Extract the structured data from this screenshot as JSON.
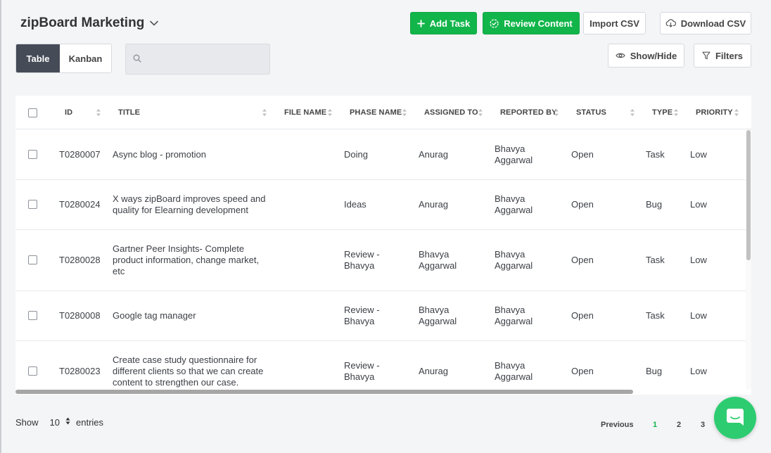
{
  "header": {
    "project_name": "zipBoard Marketing",
    "add_task": "Add Task",
    "review_content": "Review Content",
    "import_csv": "Import CSV",
    "download_csv": "Download CSV",
    "show_hide": "Show/Hide",
    "filters": "Filters"
  },
  "view_toggle": {
    "table": "Table",
    "kanban": "Kanban",
    "active": "Table"
  },
  "search": {
    "placeholder": ""
  },
  "table": {
    "columns": [
      "ID",
      "TITLE",
      "FILE NAME",
      "PHASE NAME",
      "ASSIGNED TO",
      "REPORTED BY",
      "STATUS",
      "TYPE",
      "PRIORITY"
    ],
    "rows": [
      {
        "id": "T0280007",
        "title": [
          "Async blog - promotion"
        ],
        "file_name": "",
        "phase": [
          "Doing"
        ],
        "assigned": [
          "Anurag"
        ],
        "reported": [
          "Bhavya",
          "Aggarwal"
        ],
        "status": "Open",
        "type": "Task",
        "priority": "Low"
      },
      {
        "id": "T0280024",
        "title": [
          "X ways zipBoard improves speed and",
          "quality for Elearning development"
        ],
        "file_name": "",
        "phase": [
          "Ideas"
        ],
        "assigned": [
          "Anurag"
        ],
        "reported": [
          "Bhavya",
          "Aggarwal"
        ],
        "status": "Open",
        "type": "Bug",
        "priority": "Low"
      },
      {
        "id": "T0280028",
        "title": [
          "Gartner Peer Insights- Complete",
          "product information, change market,",
          "etc"
        ],
        "file_name": "",
        "phase": [
          "Review -",
          "Bhavya"
        ],
        "assigned": [
          "Bhavya",
          "Aggarwal"
        ],
        "reported": [
          "Bhavya",
          "Aggarwal"
        ],
        "status": "Open",
        "type": "Task",
        "priority": "Low"
      },
      {
        "id": "T0280008",
        "title": [
          "Google tag manager"
        ],
        "file_name": "",
        "phase": [
          "Review -",
          "Bhavya"
        ],
        "assigned": [
          "Bhavya",
          "Aggarwal"
        ],
        "reported": [
          "Bhavya",
          "Aggarwal"
        ],
        "status": "Open",
        "type": "Task",
        "priority": "Low"
      },
      {
        "id": "T0280023",
        "title": [
          "Create case study questionnaire for",
          "different clients so that we can create",
          "content to strengthen our case."
        ],
        "file_name": "",
        "phase": [
          "Review -",
          "Bhavya"
        ],
        "assigned": [
          "Anurag"
        ],
        "reported": [
          "Bhavya",
          "Aggarwal"
        ],
        "status": "Open",
        "type": "Bug",
        "priority": "Low"
      }
    ]
  },
  "footer": {
    "show_label": "Show",
    "entries_value": "10",
    "entries_label": "entries",
    "previous": "Previous",
    "pages": [
      "1",
      "2",
      "3"
    ],
    "active_page": "1"
  },
  "colors": {
    "primary_green": "#12b54a",
    "active_toggle": "#454b57",
    "chat_bubble": "#2ecc71"
  },
  "icons": [
    "chevron-down-icon",
    "plus-icon",
    "check-circle-icon",
    "cloud-download-icon",
    "eye-icon",
    "filter-icon",
    "search-icon",
    "sort-icon",
    "chat-icon"
  ]
}
